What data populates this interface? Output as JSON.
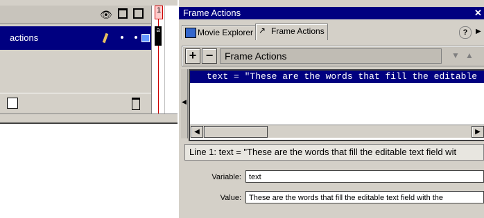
{
  "timeline": {
    "layer_name": "actions",
    "playhead_frame": "1",
    "frame_marker": "a"
  },
  "panel": {
    "title": "Frame Actions",
    "tabs": [
      {
        "label": "Movie Explorer"
      },
      {
        "label": "Frame Actions"
      }
    ],
    "toolbar": {
      "add_label": "+",
      "remove_label": "−",
      "selector_label": "Frame Actions"
    },
    "code_line": "text = \"These are the words that fill the editable",
    "status_text": "Line 1: text = \"These are the words that fill the editable text field wit",
    "variable_label": "Variable:",
    "variable_value": "text",
    "value_label": "Value:",
    "value_value": "These are the words that fill the editable text field with the"
  },
  "colors": {
    "selection": "#000080",
    "face": "#d4d0c8",
    "playhead": "#cc0000"
  }
}
